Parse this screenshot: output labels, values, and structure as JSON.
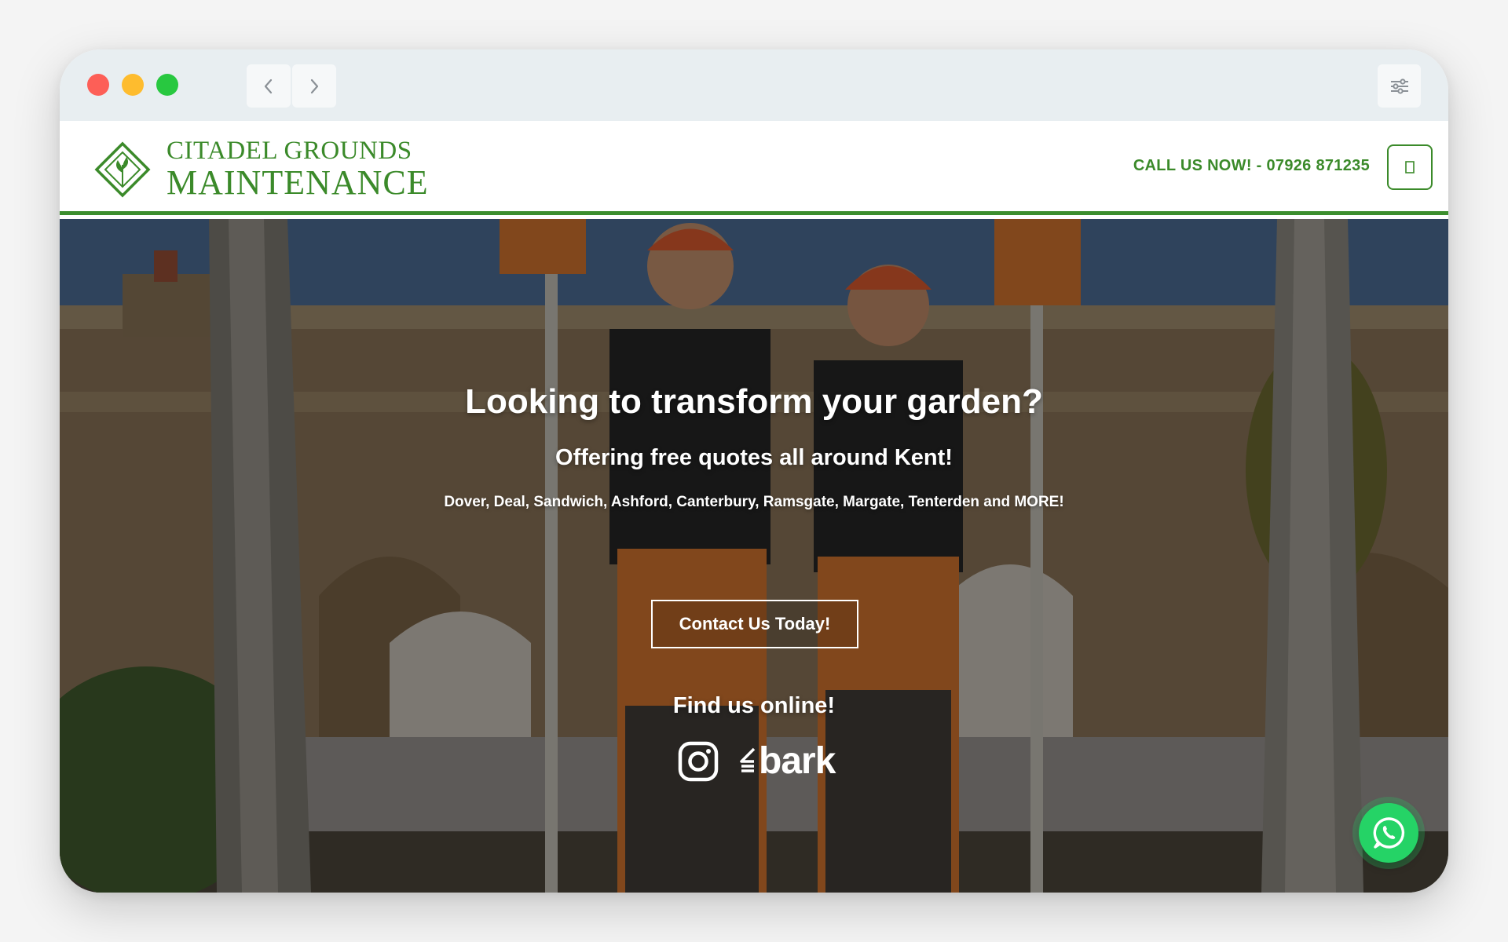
{
  "browser": {
    "back_icon": "chevron-left-icon",
    "forward_icon": "chevron-right-icon",
    "settings_icon": "sliders-icon"
  },
  "header": {
    "logo_line1": "CITADEL GROUNDS",
    "logo_line2": "MAINTENANCE",
    "call_text": "CALL US NOW! - 07926 871235",
    "menu_icon": "menu-icon",
    "brand_color": "#3b8a2a"
  },
  "hero": {
    "title": "Looking to transform your garden?",
    "subtitle": "Offering free quotes all around Kent!",
    "towns": "Dover, Deal, Sandwich, Ashford, Canterbury, Ramsgate, Margate, Tenterden and MORE!",
    "cta_label": "Contact Us Today!",
    "find_online": "Find us online!",
    "social": [
      {
        "name": "instagram-icon"
      },
      {
        "name": "bark-logo",
        "label": "bark"
      }
    ]
  },
  "floating": {
    "whatsapp_icon": "whatsapp-icon",
    "whatsapp_color": "#25d366"
  }
}
